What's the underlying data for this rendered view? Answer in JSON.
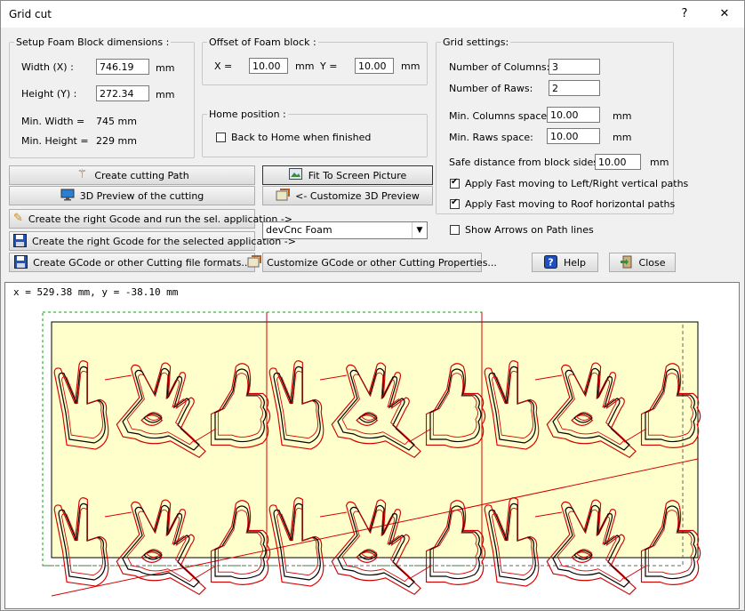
{
  "window": {
    "title": "Grid cut",
    "help_glyph": "?",
    "close_glyph": "✕"
  },
  "foam_block": {
    "legend": "Setup Foam Block dimensions :",
    "width_label": "Width (X) :",
    "width_value": "746.19",
    "width_unit": "mm",
    "height_label": "Height (Y) :",
    "height_value": "272.34",
    "height_unit": "mm",
    "min_width_label": "Min. Width =",
    "min_width_value": "745 mm",
    "min_height_label": "Min. Height =",
    "min_height_value": "229 mm"
  },
  "offset": {
    "legend": "Offset of Foam block :",
    "x_label": "X =",
    "x_value": "10.00",
    "x_unit": "mm",
    "y_label": "Y =",
    "y_value": "10.00",
    "y_unit": "mm"
  },
  "home": {
    "legend": "Home position :",
    "back_home_label": "Back to Home when finished",
    "back_home_checked": false
  },
  "grid": {
    "legend": "Grid settings:",
    "columns_label": "Number of Columns:",
    "columns_value": "3",
    "rows_label": "Number of Raws:",
    "rows_value": "2",
    "col_space_label": "Min. Columns space:",
    "col_space_value": "10.00",
    "col_space_unit": "mm",
    "row_space_label": "Min. Raws space:",
    "row_space_value": "10.00",
    "row_space_unit": "mm",
    "safe_label": "Safe distance from block sides:",
    "safe_value": "10.00",
    "safe_unit": "mm",
    "fast_lr_label": "Apply Fast moving to Left/Right vertical paths",
    "fast_lr_checked": true,
    "fast_roof_label": "Apply Fast moving to Roof horizontal paths",
    "fast_roof_checked": true
  },
  "show_arrows": {
    "label": "Show Arrows on Path lines",
    "checked": false
  },
  "buttons": {
    "create_path": "Create cutting Path",
    "preview_3d": "3D Preview of the cutting",
    "create_run": "Create the right Gcode and run the sel. application ->",
    "create_selected": "Create the right Gcode for the selected application ->",
    "create_formats": "Create GCode or other Cutting file formats...",
    "fit_screen": "Fit To Screen Picture",
    "customize_3d": "<- Customize 3D Preview",
    "customize_gcode": "Customize GCode or other Cutting Properties...",
    "help": "Help",
    "close": "Close"
  },
  "app_select": {
    "value": "devCnc Foam"
  },
  "preview": {
    "coords": "x = 529.38 mm, y = -38.10 mm",
    "columns": 3,
    "rows": 2,
    "block_fill": "#ffffcc",
    "path_color": "#d40000"
  },
  "colors": {
    "help_icon": "#2050c0",
    "window_bg": "#f0f0f0"
  }
}
